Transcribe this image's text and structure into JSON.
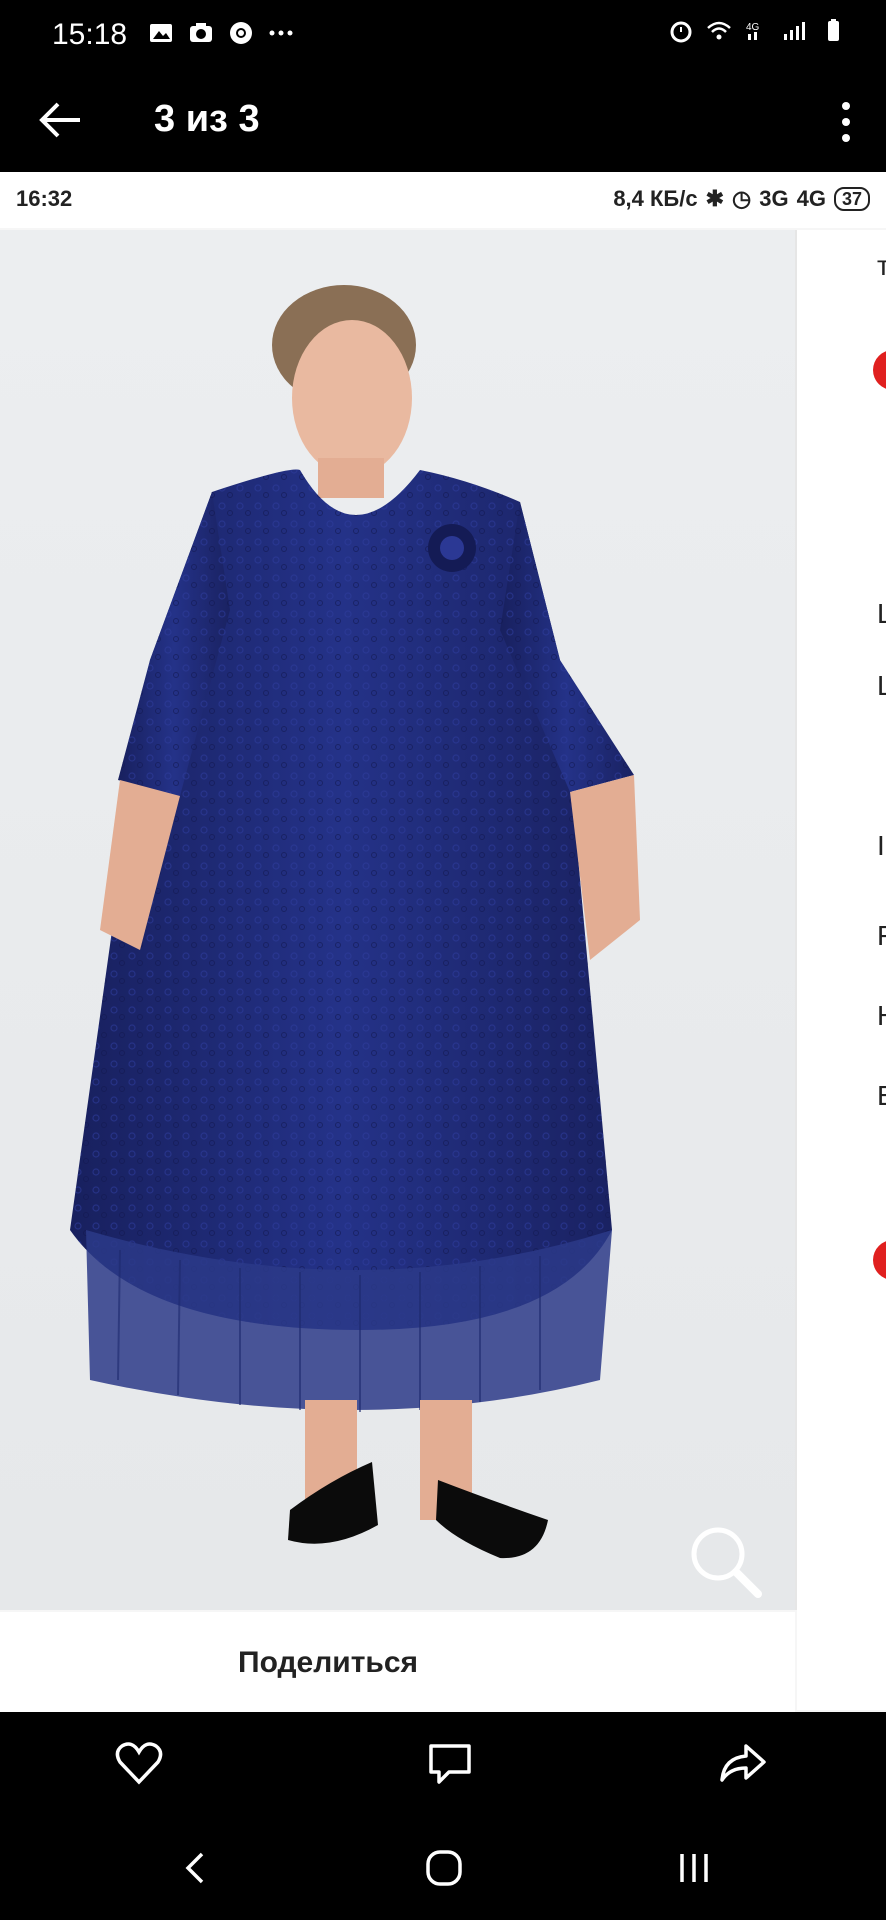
{
  "status_bar": {
    "time": "15:18"
  },
  "app_bar": {
    "title": "3 из 3"
  },
  "inner_status": {
    "time": "16:32",
    "speed": "8,4 КБ/с",
    "net1": "3G",
    "net2": "4G",
    "battery": "37"
  },
  "share": {
    "label": "Поделиться"
  },
  "icons": [
    "back-arrow-icon",
    "more-icon",
    "zoom-icon",
    "heart-icon",
    "comment-icon",
    "share-icon",
    "nav-back-icon",
    "nav-home-icon",
    "nav-recents-icon"
  ]
}
